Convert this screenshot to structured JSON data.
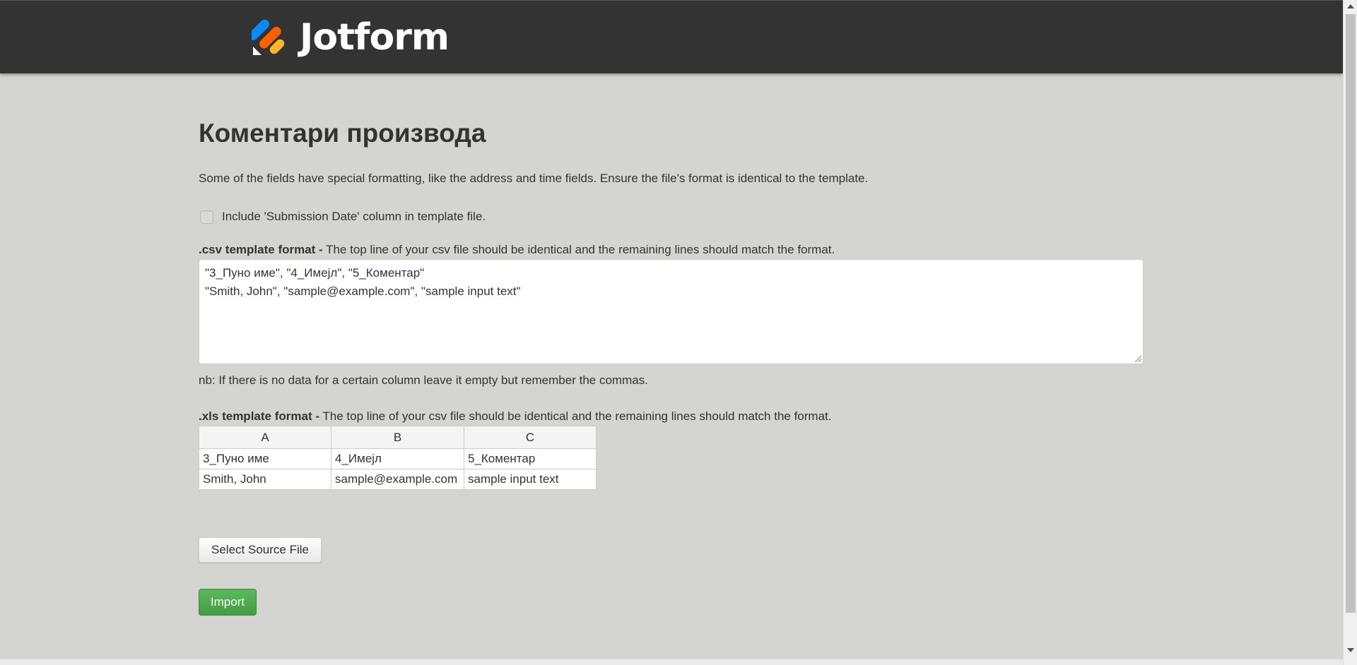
{
  "header": {
    "brand": "Jotform",
    "colors": {
      "bar": "#333333",
      "logo_blue": "#0a8af8",
      "logo_orange": "#ff6100",
      "logo_yellow": "#ffb629"
    }
  },
  "main": {
    "title": "Коментари производа",
    "description": "Some of the fields have special formatting, like the address and time fields. Ensure the file's format is identical to the template.",
    "checkbox": {
      "label": "Include 'Submission Date' column in template file.",
      "checked": false
    },
    "csv": {
      "label_bold": ".csv template format -",
      "label_rest": " The top line of your csv file should be identical and the remaining lines should match the format.",
      "content": "\"3_Пуно име\", \"4_Имејл\", \"5_Коментар\"\n\"Smith, John\", \"sample@example.com\", \"sample input text\""
    },
    "nb": "nb: If there is no data for a certain column leave it empty but remember the commas.",
    "xls": {
      "label_bold": ".xls template format -",
      "label_rest": " The top line of your csv file should be identical and the remaining lines should match the format.",
      "headers": [
        "A",
        "B",
        "C"
      ],
      "rows": [
        [
          "3_Пуно име",
          "4_Имејл",
          "5_Коментар"
        ],
        [
          "Smith, John",
          "sample@example.com",
          "sample input text"
        ]
      ]
    },
    "select_button": "Select Source File",
    "import_button": "Import",
    "import_color": "#5cb85c"
  }
}
